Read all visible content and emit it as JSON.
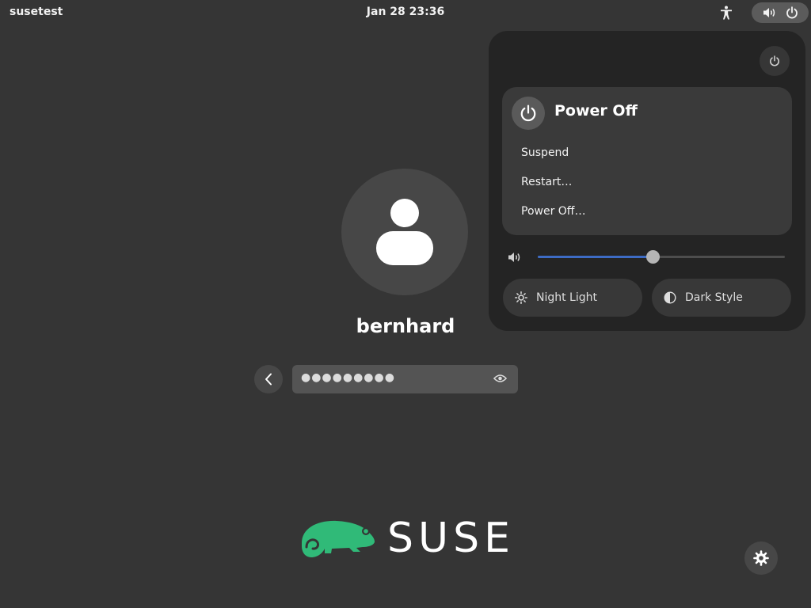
{
  "topbar": {
    "hostname": "susetest",
    "clock": "Jan 28  23:36",
    "icons": [
      "accessibility-icon",
      "volume-icon",
      "power-icon"
    ]
  },
  "login": {
    "username": "bernhard",
    "password_masked": "●●●●●●●●●",
    "icons": [
      "avatar-icon",
      "back-icon",
      "eye-icon"
    ]
  },
  "system_menu": {
    "power_submenu": {
      "title": "Power Off",
      "items": [
        "Suspend",
        "Restart…",
        "Power Off…"
      ]
    },
    "volume_level": 0.465,
    "toggles": [
      {
        "label": "Night Light",
        "icon": "sun-icon"
      },
      {
        "label": "Dark Style",
        "icon": "contrast-icon"
      }
    ]
  },
  "branding": {
    "logo_text": "SUSE",
    "logo_color": "#30ba78"
  },
  "colors": {
    "accent": "#3d6bc4",
    "background": "#353535",
    "menu_bg": "#242424"
  }
}
